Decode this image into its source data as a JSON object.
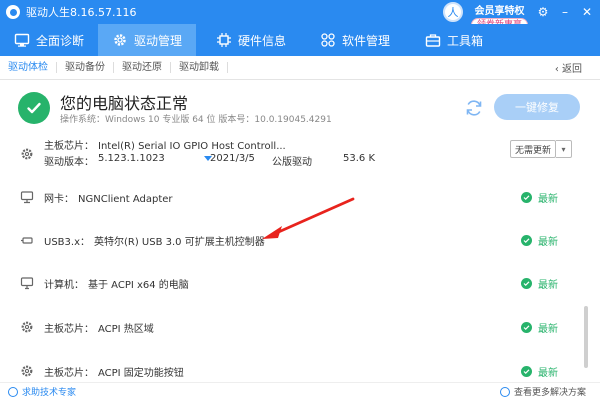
{
  "app": {
    "title": "驱动人生8.16.57.116"
  },
  "titlebar": {
    "vip_title": "会员享特权",
    "vip_badge": "领券新惠享",
    "avatar_letter": "人"
  },
  "nav": [
    {
      "label": "全面诊断",
      "icon": "monitor-icon"
    },
    {
      "label": "驱动管理",
      "icon": "gear-icon"
    },
    {
      "label": "硬件信息",
      "icon": "cpu-icon"
    },
    {
      "label": "软件管理",
      "icon": "apps-icon"
    },
    {
      "label": "工具箱",
      "icon": "toolbox-icon"
    }
  ],
  "subtabs": [
    "驱动体检",
    "驱动备份",
    "驱动还原",
    "驱动卸载"
  ],
  "back_label": "返回",
  "status": {
    "title": "您的电脑状态正常",
    "subtitle": "操作系统：Windows 10 专业版 64 位      版本号：10.0.19045.4291",
    "fix_button": "一键修复"
  },
  "drivers": [
    {
      "icon": "gear-icon",
      "category": "主板芯片：",
      "name": "Intel(R) Serial IO GPIO Host Controll...",
      "version_label": "驱动版本：",
      "version": "5.123.1.1023",
      "date": "2021/3/5",
      "type": "公版驱动",
      "size": "53.6 K",
      "action": "无需更新"
    },
    {
      "icon": "network-icon",
      "category": "网卡：",
      "name": "NGNClient Adapter",
      "status": "最新"
    },
    {
      "icon": "usb-icon",
      "category": "USB3.x：",
      "name": "英特尔(R) USB 3.0 可扩展主机控制器",
      "status": "最新"
    },
    {
      "icon": "computer-icon",
      "category": "计算机：",
      "name": "基于 ACPI x64 的电脑",
      "status": "最新"
    },
    {
      "icon": "gear-icon",
      "category": "主板芯片：",
      "name": "ACPI 热区域",
      "status": "最新"
    },
    {
      "icon": "gear-icon",
      "category": "主板芯片：",
      "name": "ACPI 固定功能按钮",
      "status": "最新"
    }
  ],
  "footer": {
    "left": "求助技术专家",
    "right": "查看更多解决方案"
  },
  "colors": {
    "brand": "#2a8af0",
    "success": "#27b36b",
    "annotation": "#e8231d"
  }
}
